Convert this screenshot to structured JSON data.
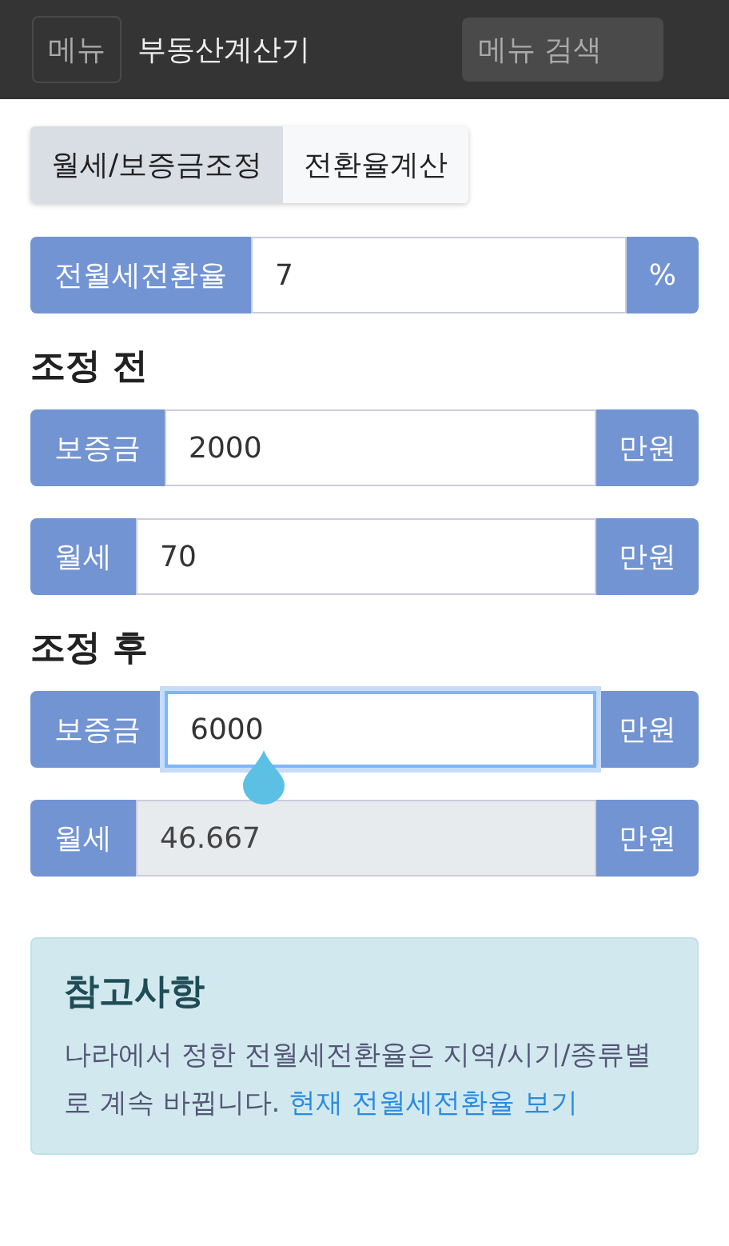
{
  "navbar": {
    "menu_button": "메뉴",
    "title": "부동산계산기",
    "search": {
      "placeholder": "메뉴 검색"
    }
  },
  "tabs": [
    {
      "label": "월세/보증금조정",
      "selected": true
    },
    {
      "label": "전환율계산",
      "selected": false
    }
  ],
  "rate_field": {
    "prefix": "전월세전환율",
    "value": "7",
    "suffix": "%",
    "focused": false,
    "disabled": false
  },
  "sections": [
    {
      "heading": "조정 전",
      "fields": [
        {
          "prefix": "보증금",
          "value": "2000",
          "suffix": "만원",
          "focused": false,
          "disabled": false
        },
        {
          "prefix": "월세",
          "value": "70",
          "suffix": "만원",
          "focused": false,
          "disabled": false
        }
      ]
    },
    {
      "heading": "조정 후",
      "fields": [
        {
          "prefix": "보증금",
          "value": "6000",
          "suffix": "만원",
          "focused": true,
          "disabled": false
        },
        {
          "prefix": "월세",
          "value": "46.667",
          "suffix": "만원",
          "focused": false,
          "disabled": true
        }
      ]
    }
  ],
  "note": {
    "title": "참고사항",
    "text": "나라에서 정한 전월세전환율은 지역/시기/종류별로 계속 바뀝니다.",
    "link": "현재 전월세전환율 보기"
  }
}
